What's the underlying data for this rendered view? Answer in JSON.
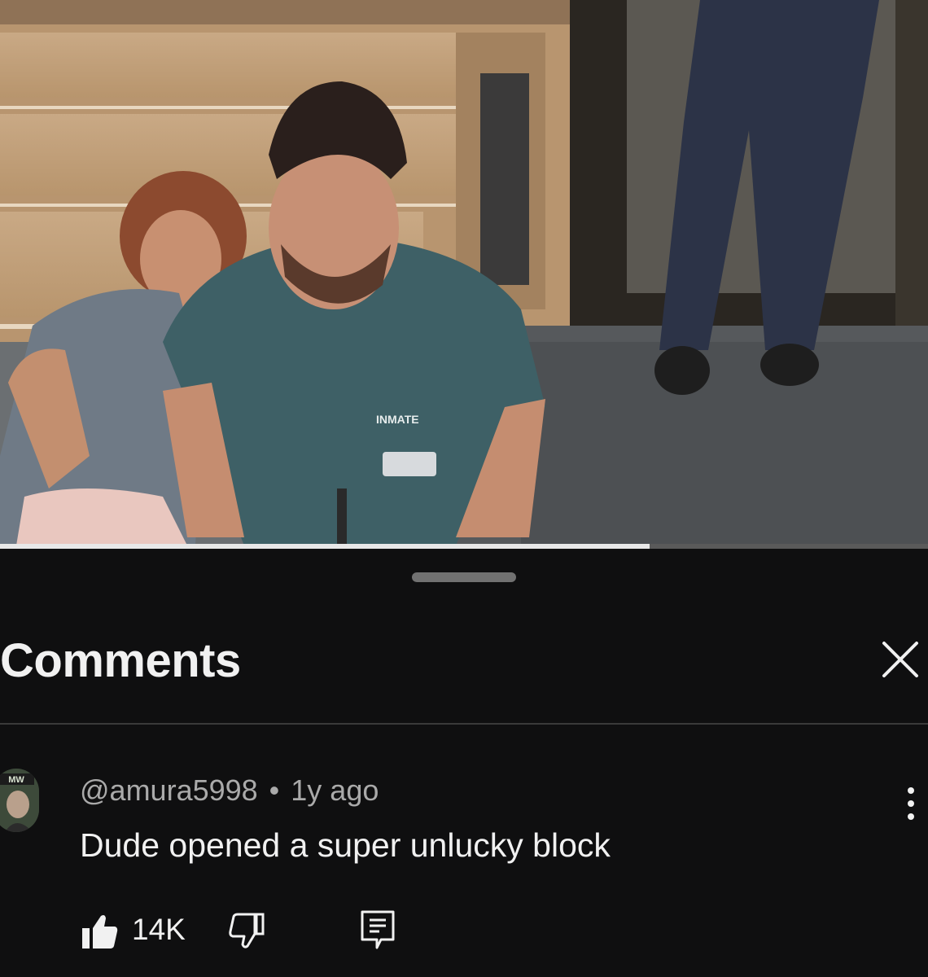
{
  "video": {
    "scene": "courtroom",
    "shirt_label": "INMATE",
    "progress_fraction": 0.7
  },
  "comments_panel": {
    "title": "Comments",
    "close_icon": "close-icon"
  },
  "comment": {
    "handle": "@amura5998",
    "separator": "•",
    "time": "1y ago",
    "text": "Dude opened a super unlucky block",
    "like_count": "14K",
    "avatar_label": "MW",
    "icons": [
      "thumbs-up-icon",
      "thumbs-down-icon",
      "reply-icon",
      "more-vert-icon"
    ]
  },
  "colors": {
    "background": "#0f0f10",
    "text_primary": "#f1f1f1",
    "text_secondary": "#aaaaaa",
    "divider": "#3a3a3a"
  }
}
